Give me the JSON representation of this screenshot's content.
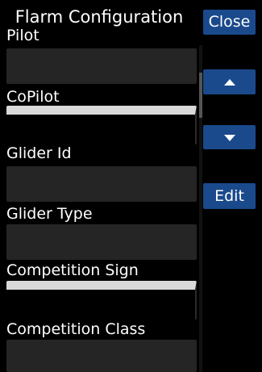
{
  "dialog": {
    "title": "Flarm Configuration"
  },
  "fields": [
    {
      "label": "Pilot",
      "value": ""
    },
    {
      "label": "CoPilot",
      "value": ""
    },
    {
      "label": "Glider Id",
      "value": ""
    },
    {
      "label": "Glider Type",
      "value": ""
    },
    {
      "label": "Competition Sign",
      "value": ""
    },
    {
      "label": "Competition Class",
      "value": ""
    }
  ],
  "buttons": {
    "close_label": "Close",
    "up_icon": "triangle-up-icon",
    "down_icon": "triangle-down-icon",
    "edit_label": "Edit"
  },
  "colors": {
    "button": "#1a4a8c",
    "field": "#252525",
    "background": "#000000",
    "text": "#ffffff"
  }
}
